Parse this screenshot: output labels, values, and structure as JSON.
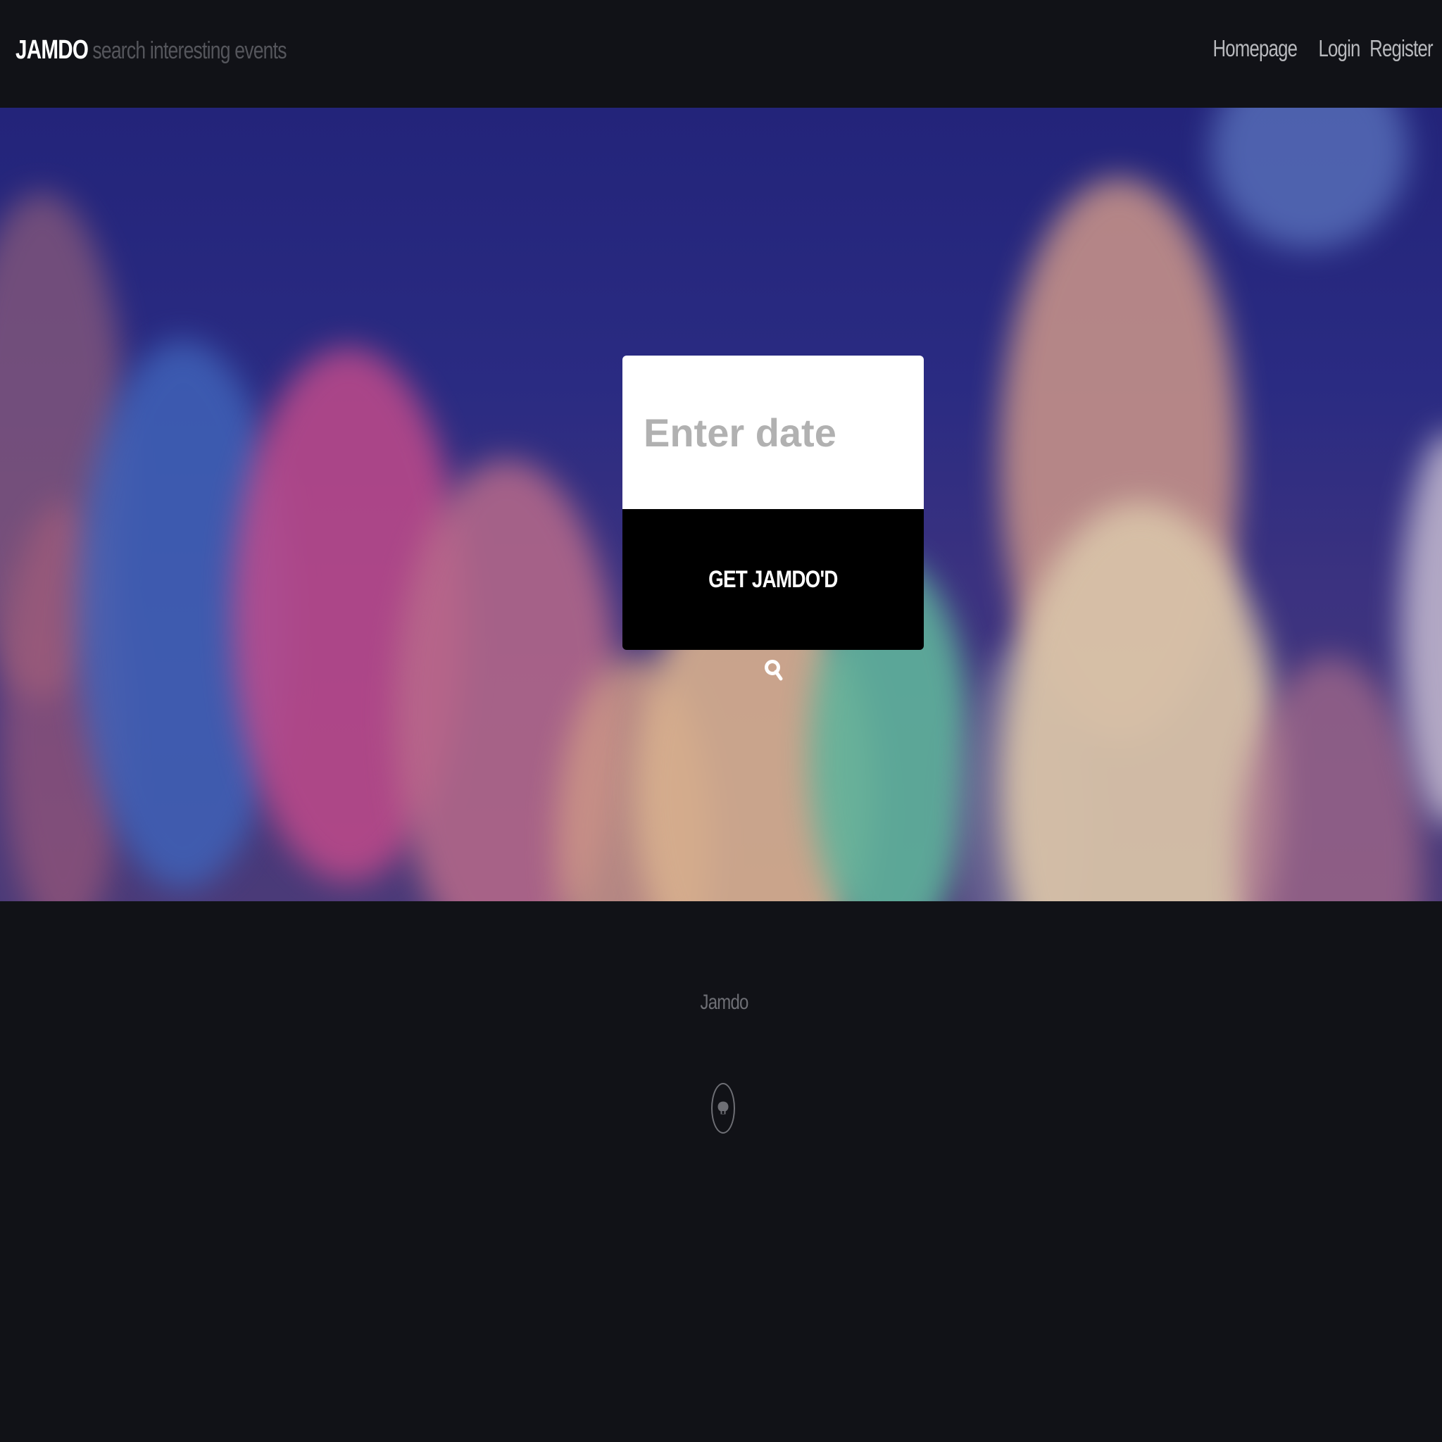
{
  "navbar": {
    "brand": "JAMDO",
    "tagline": "search interesting events",
    "links": [
      {
        "label": "Homepage"
      },
      {
        "label": "Login"
      },
      {
        "label": "Register"
      }
    ]
  },
  "search": {
    "placeholder": "Enter date",
    "button_label": "GET JAMDO'D",
    "icon": "search-icon"
  },
  "footer": {
    "brand": "Jamdo",
    "social_icon": "github-icon"
  },
  "colors": {
    "background": "#111217",
    "button": "#000000",
    "input": "#ffffff"
  }
}
